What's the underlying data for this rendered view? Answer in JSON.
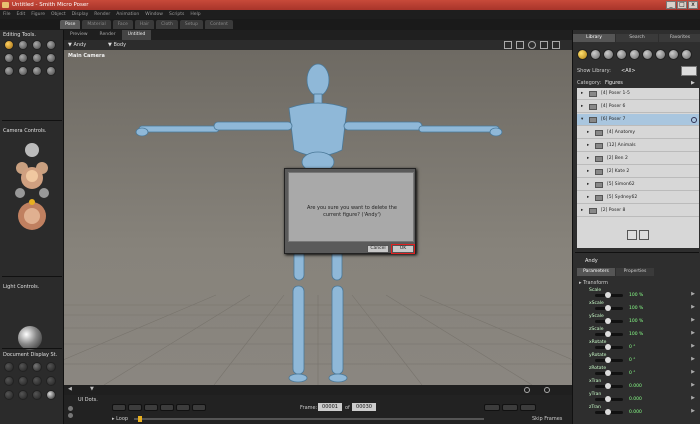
{
  "window": {
    "title": "Untitled - Smith Micro Poser",
    "min_glyph": "_",
    "max_glyph": "□",
    "close_glyph": "x"
  },
  "menu": [
    "File",
    "Edit",
    "Figure",
    "Object",
    "Display",
    "Render",
    "Animation",
    "Window",
    "Scripts",
    "Help"
  ],
  "rooms": [
    "Pose",
    "Material",
    "Face",
    "Hair",
    "Cloth",
    "Setup",
    "Content"
  ],
  "left": {
    "editing_tools": "Editing Tools.",
    "camera_controls": "Camera Controls.",
    "light_controls": "Light Controls.",
    "document_display": "Document Display St."
  },
  "viewport": {
    "tabs": [
      "Preview",
      "Render",
      "Untitled"
    ],
    "figure": "Andy",
    "body": "Body",
    "camera": "Main Camera"
  },
  "dialog": {
    "message_line1": "Are you sure you want to delete the",
    "message_line2": "current figure?  ('Andy')",
    "cancel": "Cancel",
    "ok": "OK"
  },
  "animation": {
    "ui_dots": "UI Dots.",
    "frame_label": "Frame:",
    "frame_value": "00001",
    "of": "of",
    "total": "00030",
    "loop": "Loop",
    "skip_frames": "Skip Frames"
  },
  "library": {
    "tabs": [
      "Library",
      "Search",
      "Favorites"
    ],
    "show_library": "Show Library:",
    "show_value": "<All>",
    "category_label": "Category:",
    "category_value": "Figures",
    "items": [
      {
        "text": "[4]   Poser 1-5",
        "indent": 0,
        "selected": false
      },
      {
        "text": "[4]   Poser 6",
        "indent": 0,
        "selected": false
      },
      {
        "text": "[6]   Poser 7",
        "indent": 0,
        "selected": true
      },
      {
        "text": "[4]   Anatomy",
        "indent": 1,
        "selected": false
      },
      {
        "text": "[12]  Animals",
        "indent": 1,
        "selected": false
      },
      {
        "text": "[2]   Ben 2",
        "indent": 1,
        "selected": false
      },
      {
        "text": "[2]   Kate 2",
        "indent": 1,
        "selected": false
      },
      {
        "text": "[5]   Simon62",
        "indent": 1,
        "selected": false
      },
      {
        "text": "[5]   Sydney62",
        "indent": 1,
        "selected": false
      },
      {
        "text": "[2]   Poser 8",
        "indent": 0,
        "selected": false
      }
    ]
  },
  "params": {
    "figure": "Andy",
    "tabs": [
      "Parameters",
      "Properties"
    ],
    "group": "Transform",
    "rows": [
      {
        "name": "Scale",
        "value": "100 %"
      },
      {
        "name": "xScale",
        "value": "100 %"
      },
      {
        "name": "yScale",
        "value": "100 %"
      },
      {
        "name": "zScale",
        "value": "100 %"
      },
      {
        "name": "xRotate",
        "value": "0 °"
      },
      {
        "name": "yRotate",
        "value": "0 °"
      },
      {
        "name": "zRotate",
        "value": "0 °"
      },
      {
        "name": "xTran",
        "value": "0.000"
      },
      {
        "name": "yTran",
        "value": "0.000"
      },
      {
        "name": "zTran",
        "value": "0.000"
      }
    ]
  },
  "colors": {
    "accent": "#e8b020",
    "ok_highlight": "#e02020",
    "selection": "#a9c6df",
    "figure": "#8fb8d8"
  }
}
